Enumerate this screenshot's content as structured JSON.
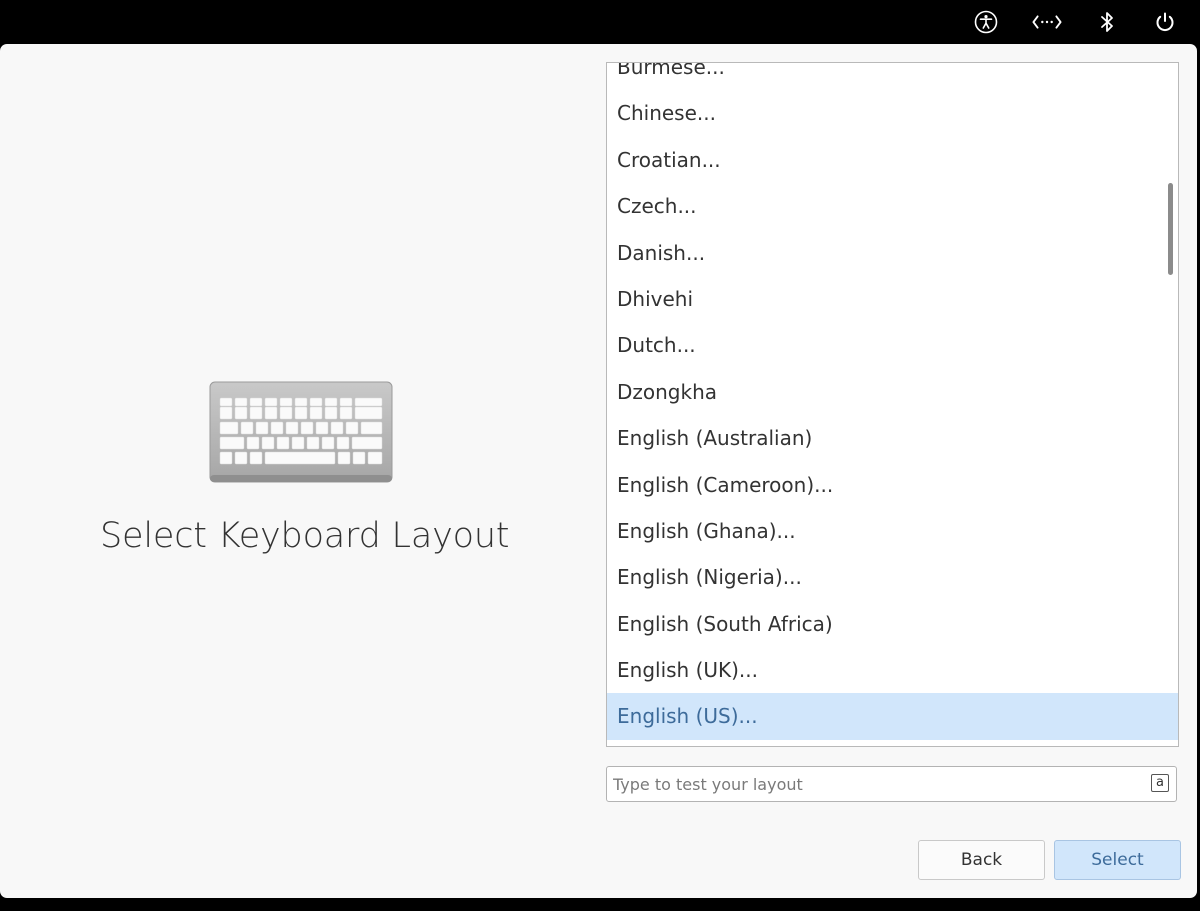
{
  "topbar": {
    "icons": [
      "accessibility-icon",
      "network-icon",
      "bluetooth-icon",
      "power-icon"
    ]
  },
  "main": {
    "title": "Select Keyboard Layout",
    "art_icon": "keyboard-icon"
  },
  "layouts": {
    "items": [
      "Burmese...",
      "Chinese...",
      "Croatian...",
      "Czech...",
      "Danish...",
      "Dhivehi",
      "Dutch...",
      "Dzongkha",
      "English (Australian)",
      "English (Cameroon)...",
      "English (Ghana)...",
      "English (Nigeria)...",
      "English (South Africa)",
      "English (UK)...",
      "English (US)..."
    ],
    "selected": "English (US)..."
  },
  "test_field": {
    "placeholder": "Type to test your layout",
    "value": "",
    "indicator": "a"
  },
  "buttons": {
    "back_label": "Back",
    "select_label": "Select"
  },
  "colors": {
    "accent_selected_bg": "#d1e6fb",
    "accent_selected_text": "#3d6b9a",
    "topbar_bg": "#000000",
    "window_bg": "#f8f8f8"
  }
}
